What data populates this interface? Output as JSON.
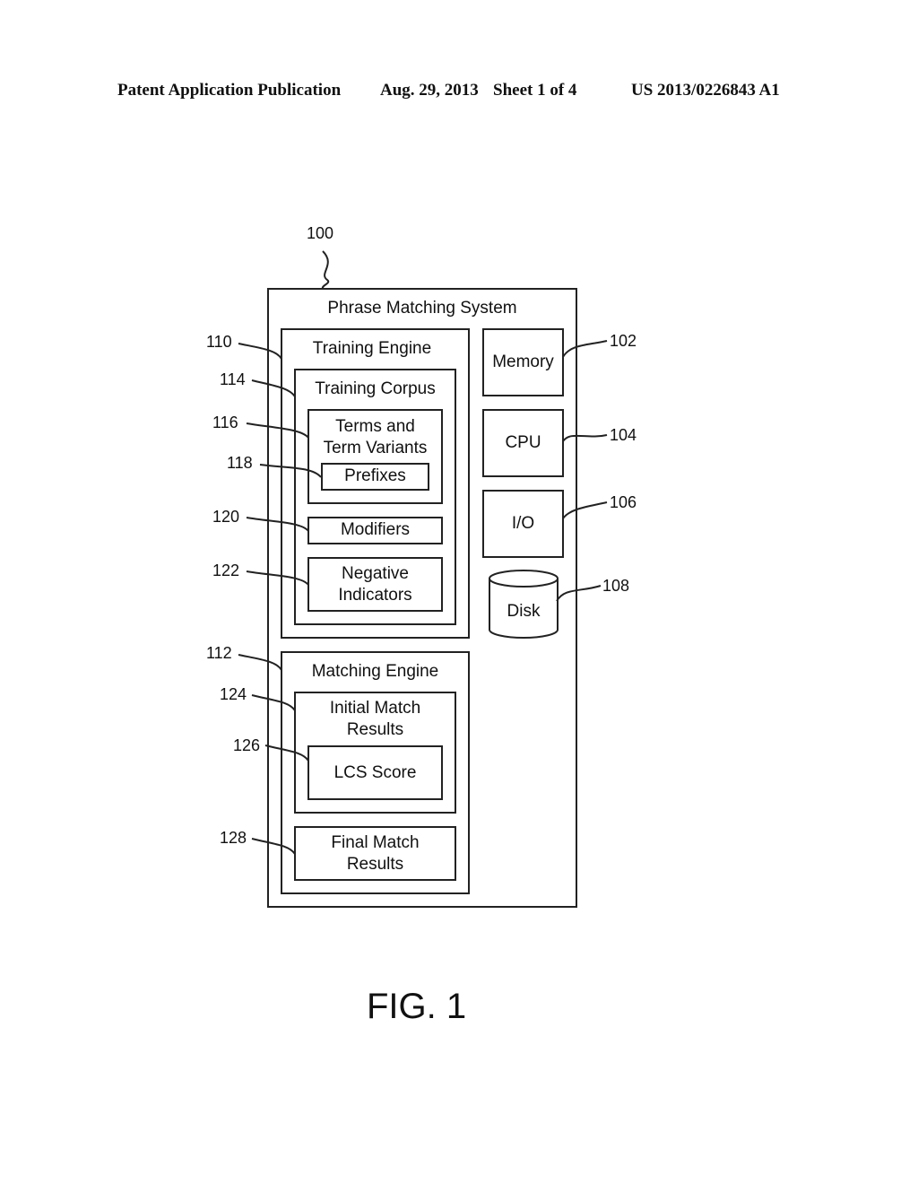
{
  "header": {
    "left": "Patent Application Publication",
    "date": "Aug. 29, 2013",
    "sheet": "Sheet 1 of 4",
    "number": "US 2013/0226843 A1"
  },
  "figure": {
    "caption": "FIG. 1",
    "system": {
      "ref": "100",
      "label": "Phrase Matching System"
    },
    "training_engine": {
      "ref": "110",
      "label": "Training Engine"
    },
    "training_corpus": {
      "ref": "114",
      "label": "Training Corpus"
    },
    "terms": {
      "ref": "116",
      "label_line1": "Terms and",
      "label_line2": "Term Variants"
    },
    "prefixes": {
      "ref": "118",
      "label": "Prefixes"
    },
    "modifiers": {
      "ref": "120",
      "label": "Modifiers"
    },
    "negative": {
      "ref": "122",
      "label_line1": "Negative",
      "label_line2": "Indicators"
    },
    "matching_engine": {
      "ref": "112",
      "label": "Matching Engine"
    },
    "initial": {
      "ref": "124",
      "label_line1": "Initial Match",
      "label_line2": "Results"
    },
    "lcs": {
      "ref": "126",
      "label": "LCS Score"
    },
    "final": {
      "ref": "128",
      "label_line1": "Final Match",
      "label_line2": "Results"
    },
    "memory": {
      "ref": "102",
      "label": "Memory"
    },
    "cpu": {
      "ref": "104",
      "label": "CPU"
    },
    "io": {
      "ref": "106",
      "label": "I/O"
    },
    "disk": {
      "ref": "108",
      "label": "Disk"
    }
  }
}
